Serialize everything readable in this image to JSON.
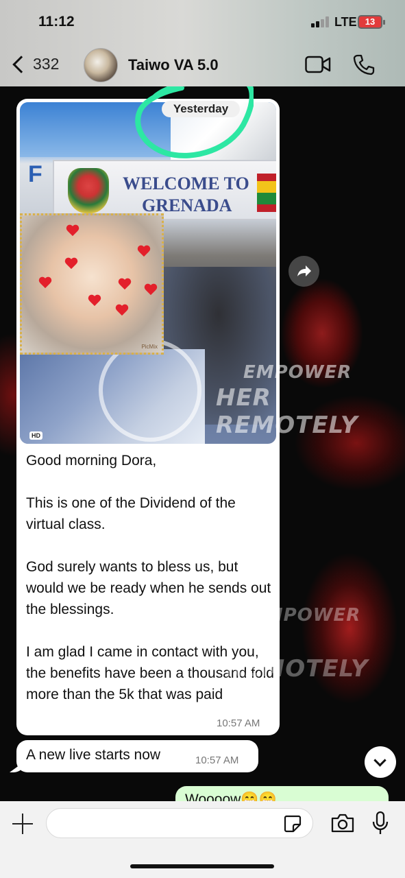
{
  "status_bar": {
    "time": "11:12",
    "network": "LTE",
    "battery": "13"
  },
  "header": {
    "back_count": "332",
    "contact_name": "Taiwo VA 5.0"
  },
  "date_label": "Yesterday",
  "watermark": {
    "line1": "EMPOWER",
    "line2": "HER REMOTELY"
  },
  "media": {
    "sign_line1": "WELCOME TO",
    "sign_line2": "GRENADA",
    "hd_badge": "HD",
    "inset_credit": "PicMix"
  },
  "messages": [
    {
      "text": "Good morning Dora,\n\nThis is one of the Dividend of the virtual class.\n\nGod surely wants to bless us, but would we be ready when he sends out the blessings.\n\nI am glad I came in contact with you, the benefits have been a thousand fold more than the 5k that was paid",
      "time": "10:57 AM"
    },
    {
      "text": "A new live starts now",
      "time": "10:57 AM"
    },
    {
      "text": "Woooow😁😁"
    }
  ],
  "composer": {
    "placeholder": ""
  },
  "colors": {
    "accent_mark": "#2de7a3",
    "outgoing_bubble": "#d9fdd3",
    "battery_low": "#e23b3b"
  }
}
